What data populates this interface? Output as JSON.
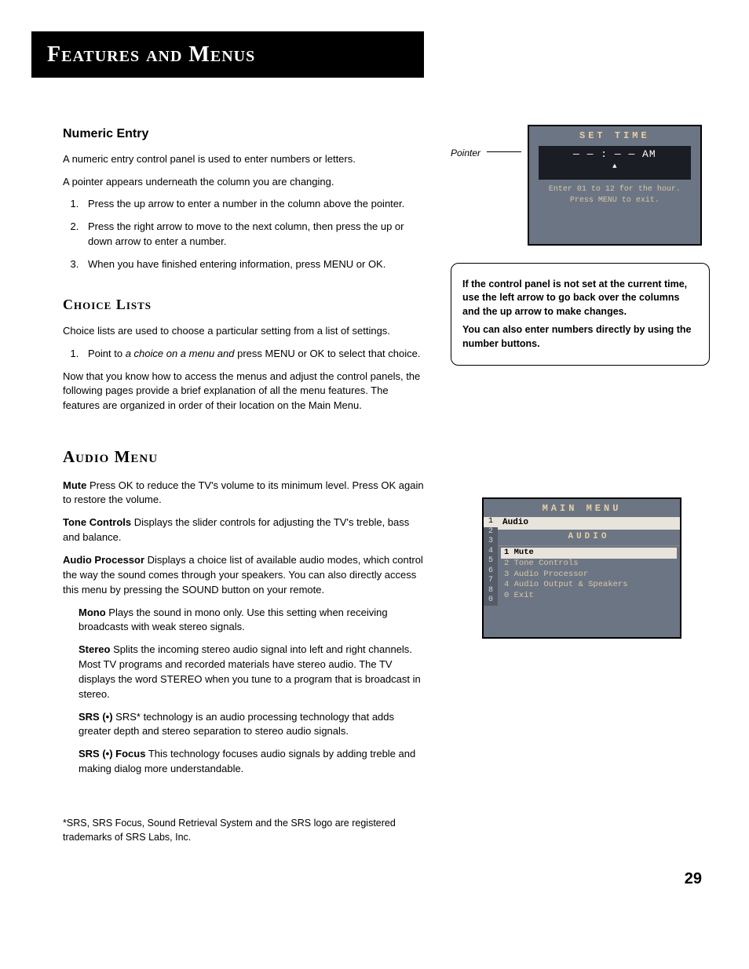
{
  "page_title": "Features and Menus",
  "page_number": "29",
  "numeric_entry": {
    "heading": "Numeric Entry",
    "intro1": "A numeric entry control panel is used to enter numbers or letters.",
    "intro2": "A pointer appears underneath the column you are changing.",
    "steps": [
      "Press the up arrow to enter a number in the column above the pointer.",
      "Press the right arrow to move to the next column, then press the up or down arrow to enter a number.",
      "When you have finished entering information, press MENU or OK."
    ]
  },
  "choice_lists": {
    "heading": "Choice Lists",
    "intro": "Choice lists are used to choose a particular setting from a list of settings.",
    "step_prefix": "Point to ",
    "step_italic": "a choice on a menu and ",
    "step_suffix": "press MENU or OK to select that choice.",
    "outro": "Now that you know how to access the menus and adjust the control panels, the following pages provide a brief explanation of all the menu features. The features are organized in order of their location on the Main Menu."
  },
  "audio_menu": {
    "heading": "Audio Menu",
    "mute_term": "Mute",
    "mute_text": "  Press OK to reduce the TV's volume to its minimum level. Press OK again to restore the volume.",
    "tone_term": "Tone Controls",
    "tone_text": "  Displays the slider controls for adjusting the TV's treble, bass and balance.",
    "ap_term": "Audio Processor",
    "ap_text": "  Displays a choice list of available audio modes, which control the way the sound comes through your speakers. You can also directly access this menu by pressing the SOUND button on your remote.",
    "mono_term": "Mono",
    "mono_text": "   Plays the sound in mono only. Use this setting when receiving broadcasts with weak stereo signals.",
    "stereo_term": "Stereo",
    "stereo_text": "   Splits the incoming stereo audio signal into left and right channels. Most TV programs and recorded materials have stereo audio. The TV displays the word STEREO when you tune to a program that is broadcast in stereo.",
    "srs_term": "SRS (•)",
    "srs_text": "  SRS* technology is an audio processing technology that adds greater depth and stereo separation to stereo audio signals.",
    "srsf_term": "SRS (•) Focus",
    "srsf_text": "  This technology focuses audio signals by adding treble and making dialog more understandable."
  },
  "footnote": "*SRS, SRS Focus, Sound Retrieval System and the SRS logo are registered trademarks of SRS Labs, Inc.",
  "osd_set_time": {
    "pointer_label": "Pointer",
    "title": "SET TIME",
    "display": "— — : — —  AM",
    "hint1": "Enter 01 to 12 for the hour.",
    "hint2": "Press MENU to exit."
  },
  "note_box": {
    "p1": "If the control panel is not set at the current time, use the left arrow to go back over the columns and the up arrow to make changes.",
    "p2": "You can also enter numbers directly by using the number buttons."
  },
  "osd_main_menu": {
    "title": "MAIN MENU",
    "rail": [
      "1",
      "2",
      "3",
      "4",
      "5",
      "6",
      "7",
      "8",
      "0"
    ],
    "top_row": "Audio",
    "subtitle": "AUDIO",
    "items": [
      "1 Mute",
      "2 Tone Controls",
      "3 Audio Processor",
      "4 Audio Output & Speakers",
      "0 Exit"
    ]
  }
}
